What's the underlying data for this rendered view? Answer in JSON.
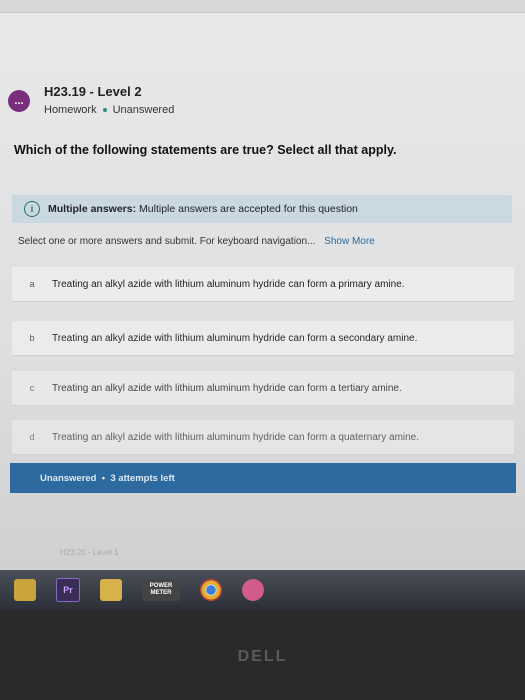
{
  "header": {
    "avatar_label": "...",
    "title": "H23.19 - Level 2",
    "type": "Homework",
    "status": "Unanswered"
  },
  "question": "Which of the following statements are true? Select all that apply.",
  "info_box": {
    "label": "Multiple answers:",
    "text": "Multiple answers are accepted for this question"
  },
  "instructions": {
    "text": "Select one or more answers and submit. For keyboard navigation...",
    "link": "Show More"
  },
  "choices": [
    {
      "letter": "a",
      "text": "Treating an alkyl azide with lithium aluminum hydride can form a primary amine."
    },
    {
      "letter": "b",
      "text": "Treating an alkyl azide with lithium aluminum hydride can form a secondary amine."
    },
    {
      "letter": "c",
      "text": "Treating an alkyl azide with lithium aluminum hydride can form a tertiary amine."
    },
    {
      "letter": "d",
      "text": "Treating an alkyl azide with lithium aluminum hydride can form a quaternary amine."
    }
  ],
  "status_bar": {
    "status": "Unanswered",
    "attempts": "3 attempts left"
  },
  "footer_strip": "H23.20 - Level 1",
  "taskbar": {
    "icons": [
      "lock-icon",
      "premiere-icon",
      "folder-icon",
      "app-icon",
      "chrome-icon",
      "app-pink-icon"
    ],
    "pr_label": "Pr",
    "pill_label": "POWER METER"
  },
  "brand": "DELL",
  "colors": {
    "accent": "#2d6aa0",
    "avatar": "#7a2f7c",
    "info_bg": "#c9d9df"
  }
}
